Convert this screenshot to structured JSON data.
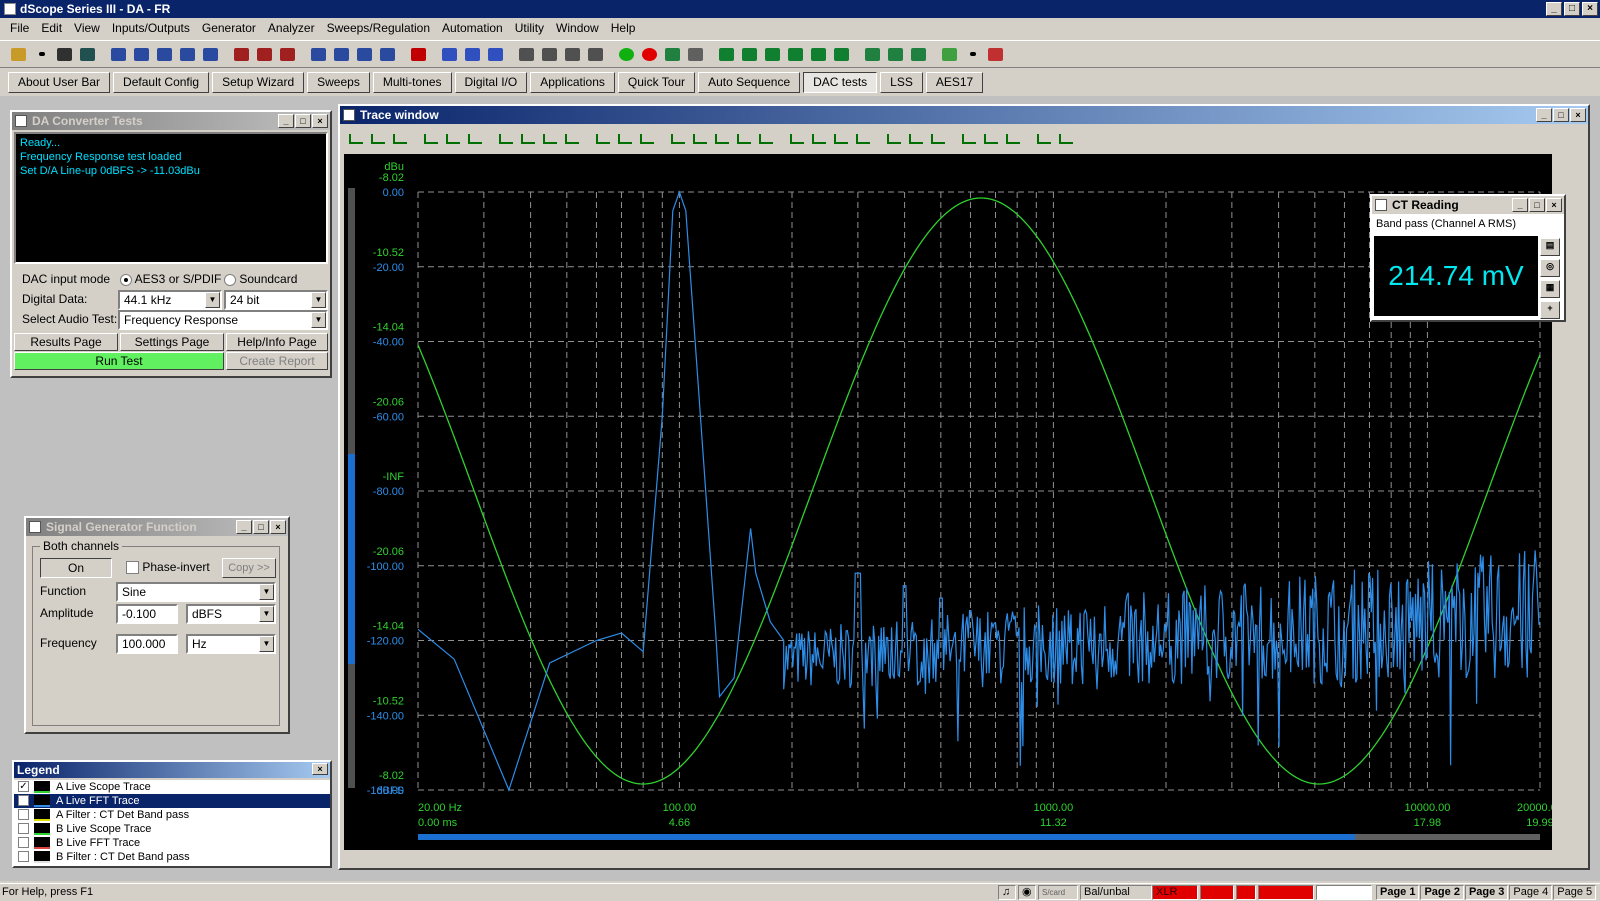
{
  "app": {
    "title": "dScope Series III - DA - FR"
  },
  "menu": [
    "File",
    "Edit",
    "View",
    "Inputs/Outputs",
    "Generator",
    "Analyzer",
    "Sweeps/Regulation",
    "Automation",
    "Utility",
    "Window",
    "Help"
  ],
  "nav_buttons": [
    "About User Bar",
    "Default Config",
    "Setup Wizard",
    "Sweeps",
    "Multi-tones",
    "Digital I/O",
    "Applications",
    "Quick Tour",
    "Auto Sequence",
    "DAC tests",
    "LSS",
    "AES17"
  ],
  "dac": {
    "title": "DA Converter Tests",
    "log": [
      "Ready...",
      "Frequency Response test loaded",
      "Set D/A Line-up 0dBFS -> -11.03dBu"
    ],
    "input_mode_label": "DAC input mode",
    "opt_aes": "AES3 or S/PDIF",
    "opt_soundcard": "Soundcard",
    "digital_data_label": "Digital Data:",
    "sample_rate": "44.1 kHz",
    "bit_depth": "24 bit",
    "select_test_label": "Select Audio Test:",
    "selected_test": "Frequency Response",
    "results_page": "Results Page",
    "settings_page": "Settings Page",
    "help_page": "Help/Info Page",
    "run_test": "Run Test",
    "create_report": "Create Report"
  },
  "siggen": {
    "title": "Signal Generator Function",
    "group": "Both channels",
    "on": "On",
    "phase_invert": "Phase-invert",
    "copy": "Copy >>",
    "function_label": "Function",
    "function_value": "Sine",
    "amplitude_label": "Amplitude",
    "amplitude_value": "-0.100",
    "amplitude_unit": "dBFS",
    "frequency_label": "Frequency",
    "frequency_value": "100.000",
    "frequency_unit": "Hz"
  },
  "legend": {
    "title": "Legend",
    "items": [
      {
        "label": "A  Live Scope Trace",
        "checked": true
      },
      {
        "label": "A  Live FFT Trace",
        "checked": true
      },
      {
        "label": "A  Filter : CT Det Band pass",
        "checked": false
      },
      {
        "label": "B  Live Scope Trace",
        "checked": false
      },
      {
        "label": "B  Live FFT Trace",
        "checked": false
      },
      {
        "label": "B  Filter : CT Det Band pass",
        "checked": false
      }
    ]
  },
  "trace_window": {
    "title": "Trace window"
  },
  "ct": {
    "title": "CT Reading",
    "subtitle": "Band pass (Channel A RMS)",
    "value": "214.74 mV"
  },
  "status": {
    "help": "For Help, press F1",
    "bal": "Bal/unbal",
    "xlr": "XLR",
    "sc": "S/card",
    "pages": [
      "Page 1",
      "Page 2",
      "Page 3",
      "Page 4",
      "Page 5"
    ]
  },
  "chart_data": {
    "type": "line",
    "left_axis_unit": "dBu",
    "bottom_axis_unit": "dBFS",
    "green_ticks": [
      "-8.02",
      "-10.52",
      "-14.04",
      "-20.06",
      "-INF",
      "-20.06",
      "-14.04",
      "-10.52",
      "-8.02"
    ],
    "blue_ticks": [
      "0.00",
      "-20.00",
      "-40.00",
      "-60.00",
      "-80.00",
      "-100.00",
      "-120.00",
      "-140.00",
      "-160.00"
    ],
    "x_ticks_freq": [
      "20.00 Hz",
      "100.00",
      "1000.00",
      "10000.00",
      "20000.00"
    ],
    "x_ticks_time": [
      "0.00 ms",
      "4.66",
      "11.32",
      "17.98",
      "19.99"
    ],
    "series": [
      {
        "name": "A  Live Scope Trace",
        "color": "#2fd12f"
      },
      {
        "name": "A  Live FFT Trace",
        "color": "#2e8de8"
      }
    ]
  }
}
